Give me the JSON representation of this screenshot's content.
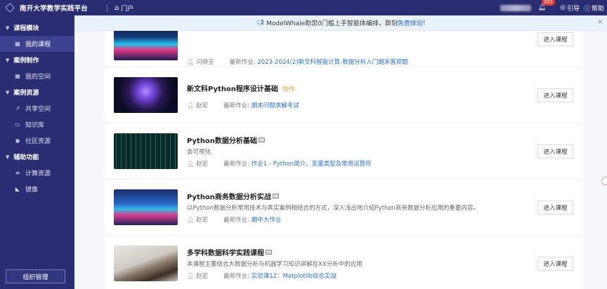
{
  "header": {
    "title": "南开大学教学实践平台",
    "portal_label": "门户",
    "notifications_count": "301",
    "guide_label": "引导",
    "help_label": "帮助"
  },
  "notice": {
    "text": "ModelWhale助您0门槛上手智能体编排，即刻",
    "link": "免费体验",
    "suffix": "!"
  },
  "sidebar": {
    "groups": [
      {
        "label": "课程模块",
        "items": [
          {
            "label": "我的课程",
            "icon": "grid-icon",
            "active": true
          }
        ]
      },
      {
        "label": "案例制作",
        "items": [
          {
            "label": "我的空间",
            "icon": "grid-icon"
          }
        ]
      },
      {
        "label": "案例资源",
        "items": [
          {
            "label": "共享空间",
            "icon": "share-icon"
          },
          {
            "label": "知识库",
            "icon": "folder-icon"
          },
          {
            "label": "社区资源",
            "icon": "globe-icon"
          }
        ]
      },
      {
        "label": "辅助功能",
        "items": [
          {
            "label": "计算资源",
            "icon": "server-icon"
          },
          {
            "label": "镜像",
            "icon": "whale-icon"
          }
        ]
      }
    ],
    "admin_button": "组织管理"
  },
  "courses": [
    {
      "title": "",
      "desc": "",
      "author": "闫晓玉",
      "latest_label": "最新作业:",
      "latest": "2023-2024(2)新文科智能计算-数据分析入门期末客观题",
      "button": "进入课程"
    },
    {
      "title": "新文科Python程序设计基础",
      "tag": "合作",
      "desc": "",
      "author": "赵宏",
      "latest_label": "最新作业:",
      "latest": "期末问题求解考试",
      "button": "进入课程"
    },
    {
      "title": "Python数据分析基础",
      "desc": "会可视化",
      "author": "赵宏",
      "latest_label": "最新作业:",
      "latest": "作业1 - Python简介、变量类型及常用运算符",
      "button": "进入课程"
    },
    {
      "title": "Python商务数据分析实战",
      "desc": "以Python数据分析常用技术与真实案例相结合的方式，深入浅出地介绍Python商务数据分析应用的重要内容。",
      "author": "赵宏",
      "latest_label": "最新作业:",
      "latest": "期中大作业",
      "button": "进入课程"
    },
    {
      "title": "多学科数据科学实践课程",
      "desc": "本课程主要结合大数据分析与机器学习知识讲解在XX分析中的应用",
      "author": "赵宏",
      "latest_label": "最新作业:",
      "latest": "实验课12：Matplotlib综合实战",
      "button": "进入课程"
    }
  ],
  "colors": {
    "sidebar": "#2a2d72",
    "accent_link": "#2b6fd6",
    "tag": "#e0a125",
    "badge": "#e53935"
  }
}
